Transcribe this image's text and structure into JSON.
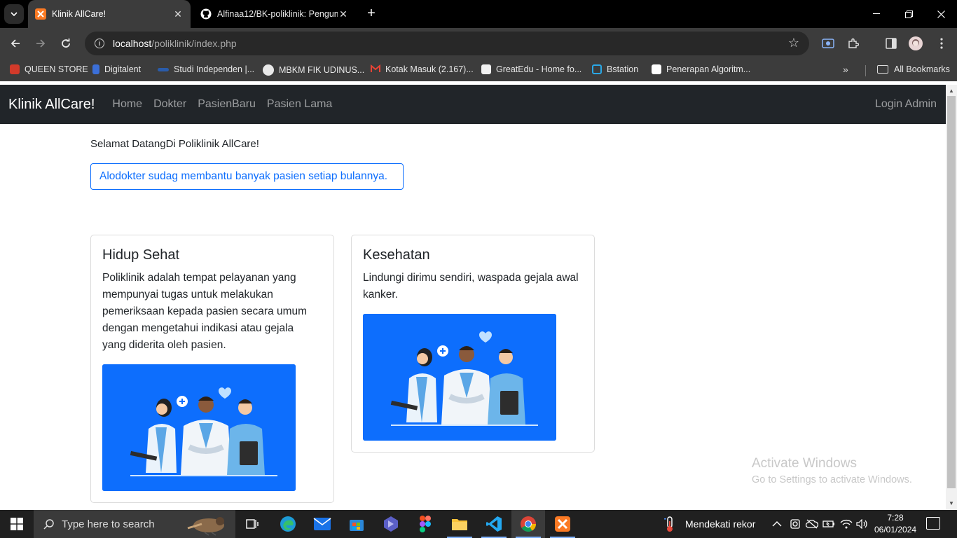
{
  "browser": {
    "tabs": [
      {
        "title": "Klinik AllCare!",
        "active": true,
        "icon": "xampp-icon"
      },
      {
        "title": "Alfinaa12/BK-poliklinik: Pengum",
        "active": false,
        "icon": "github-icon"
      }
    ],
    "url_host": "localhost",
    "url_path": "/poliklinik/index.php",
    "bookmarks": [
      {
        "label": "QUEEN STORE",
        "color": "#d23a2a"
      },
      {
        "label": "Digitalent",
        "color": "#3b6fd8"
      },
      {
        "label": "Studi Independen |...",
        "color": "#2a5caa"
      },
      {
        "label": "MBKM FIK UDINUS...",
        "color": "#e8e8e8"
      },
      {
        "label": "Kotak Masuk (2.167)...",
        "color": "#ea4335"
      },
      {
        "label": "GreatEdu - Home fo...",
        "color": "#f2f2f2"
      },
      {
        "label": "Bstation",
        "color": "#2aa8e6"
      },
      {
        "label": "Penerapan Algoritm...",
        "color": "#ffffff"
      }
    ],
    "all_bookmarks_label": "All Bookmarks"
  },
  "site": {
    "brand": "Klinik AllCare!",
    "nav": [
      "Home",
      "Dokter",
      "PasienBaru",
      "Pasien Lama"
    ],
    "login": "Login Admin",
    "welcome": "Selamat DatangDi Poliklinik AllCare!",
    "alert": "Alodokter sudag membantu banyak pasien setiap bulannya.",
    "cards": [
      {
        "title": "Hidup Sehat",
        "text": "Poliklinik adalah tempat pelayanan yang mempunyai tugas untuk melakukan pemeriksaan kepada pasien secara umum dengan mengetahui indikasi atau gejala yang diderita oleh pasien."
      },
      {
        "title": "Kesehatan",
        "text": "Lindungi dirimu sendiri, waspada gejala awal kanker."
      }
    ],
    "accent": "#0d6efd"
  },
  "watermark": {
    "line1": "Activate Windows",
    "line2": "Go to Settings to activate Windows."
  },
  "taskbar": {
    "search_placeholder": "Type here to search",
    "weather_text": "Mendekati rekor",
    "time": "7:28",
    "date": "06/01/2024"
  }
}
